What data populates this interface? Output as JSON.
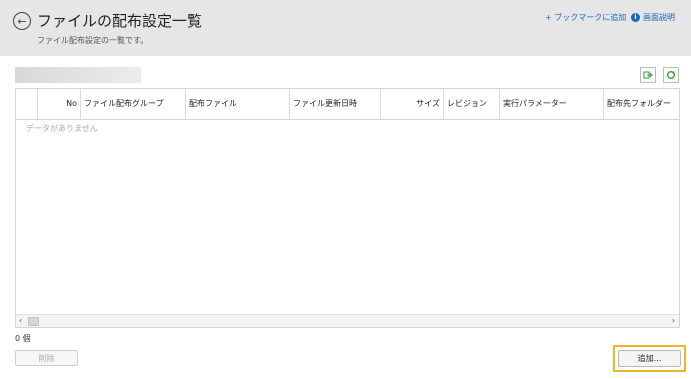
{
  "header": {
    "back_icon": "arrow-left-circle-icon",
    "title": "ファイルの配布設定一覧",
    "subtitle": "ファイル配布設定の一覧です。",
    "bookmark_link": "+ ブックマークに追加",
    "help_icon": "info-icon",
    "help_link": "画面説明"
  },
  "toolbar": {
    "export_icon": "export-icon",
    "refresh_icon": "refresh-icon"
  },
  "table": {
    "columns": [
      "No",
      "ファイル配布グループ",
      "配布ファイル",
      "ファイル更新日時",
      "サイズ",
      "レビジョン",
      "実行パラメーター",
      "配布先フォルダー"
    ],
    "empty_message": "データがありません",
    "rows": []
  },
  "footer": {
    "count": "0 個",
    "delete_label": "削除",
    "add_label": "追加..."
  },
  "colors": {
    "header_bg": "#e6e6e6",
    "link": "#1a66b8",
    "highlight": "#f0b429"
  }
}
